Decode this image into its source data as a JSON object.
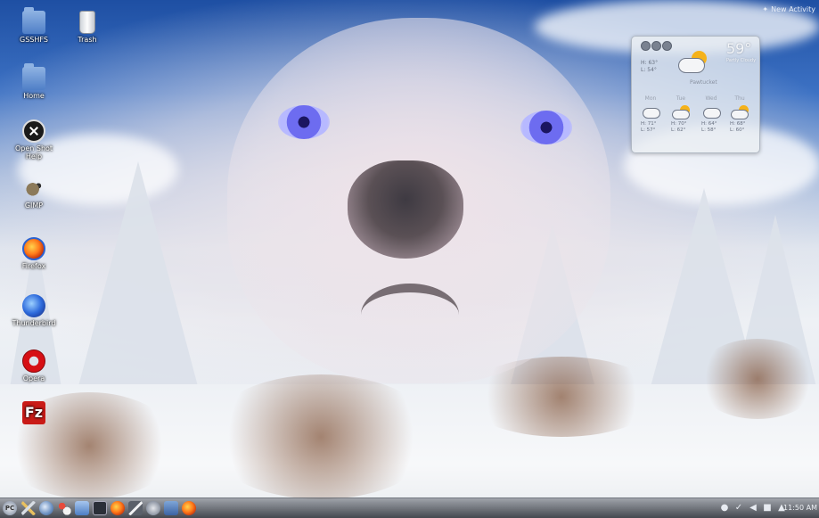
{
  "desktop": {
    "icons": [
      {
        "label": "GSSHFS",
        "icon": "folder-icon"
      },
      {
        "label": "Trash",
        "icon": "trash-icon"
      },
      {
        "label": "Home",
        "icon": "home-folder-icon"
      },
      {
        "label": "Open Shot Help",
        "icon": "openshot-icon"
      },
      {
        "label": "GIMP",
        "icon": "gimp-icon"
      },
      {
        "label": "Firefox",
        "icon": "firefox-icon"
      },
      {
        "label": "Thunderbird",
        "icon": "thunderbird-icon"
      },
      {
        "label": "Opera",
        "icon": "opera-icon"
      },
      {
        "label": "FileZilla",
        "icon": "filezilla-icon"
      }
    ],
    "activity_label": "New Activity",
    "filezilla_glyph": "Fz"
  },
  "weather": {
    "current_temp": "59°",
    "condition": "Partly Cloudy",
    "today_high": "H: 63°",
    "today_low": "L: 54°",
    "location": "Pawtucket",
    "forecast": [
      {
        "day": "Mon",
        "high": "H: 71°",
        "low": "L: 57°",
        "icon": "cloud-icon"
      },
      {
        "day": "Tue",
        "high": "H: 70°",
        "low": "L: 62°",
        "icon": "sun-cloud-icon"
      },
      {
        "day": "Wed",
        "high": "H: 64°",
        "low": "L: 58°",
        "icon": "cloud-icon"
      },
      {
        "day": "Thu",
        "high": "H: 68°",
        "low": "L: 60°",
        "icon": "sun-cloud-icon"
      }
    ]
  },
  "taskbar": {
    "kickoff_label": "PC",
    "clock": "11:50 AM",
    "colors": {
      "panel": "#2c3038"
    }
  }
}
